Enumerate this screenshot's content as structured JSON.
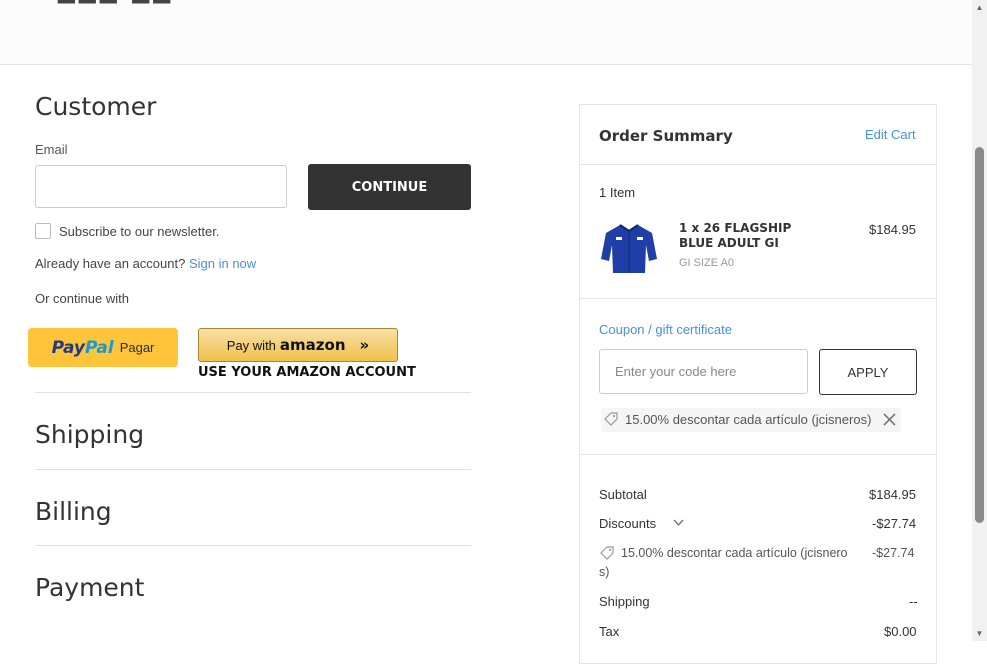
{
  "customer": {
    "title": "Customer",
    "email_label": "Email",
    "email_value": "",
    "continue_label": "CONTINUE",
    "subscribe_label": "Subscribe to our newsletter.",
    "account_prompt": "Already have an account?",
    "signin_label": "Sign in now",
    "or_continue": "Or continue with"
  },
  "payment_buttons": {
    "paypal_logo_1": "Pay",
    "paypal_logo_2": "Pal",
    "paypal_text": "Pagar",
    "amazon_pay_with": "Pay with",
    "amazon_brand": "amazon",
    "amazon_chevron": "»",
    "amazon_caption": "USE YOUR AMAZON ACCOUNT"
  },
  "sections": {
    "shipping": "Shipping",
    "billing": "Billing",
    "payment": "Payment"
  },
  "order_summary": {
    "title": "Order Summary",
    "edit_cart": "Edit Cart",
    "item_count": "1 Item",
    "item": {
      "name": "1 x 26 FLAGSHIP BLUE ADULT GI",
      "option": "GI SIZE A0",
      "price": "$184.95"
    },
    "coupon_link": "Coupon / gift certificate",
    "code_placeholder": "Enter your code here",
    "apply_label": "APPLY",
    "applied_coupon": "15.00% descontar cada artículo (jcisneros)",
    "totals": {
      "subtotal_label": "Subtotal",
      "subtotal_value": "$184.95",
      "discounts_label": "Discounts",
      "discounts_value": "-$27.74",
      "discount_detail_line1": "15.00% descontar cada artículo (jcisnero",
      "discount_detail_line2": "s)",
      "discount_detail_value": "-$27.74",
      "shipping_label": "Shipping",
      "shipping_value": "--",
      "tax_label": "Tax",
      "tax_value": "$0.00"
    }
  },
  "colors": {
    "accent_link": "#4a90d9",
    "continue_bg": "#333333",
    "paypal_yellow": "#ffc439",
    "amazon_gold": "#f0c14b"
  },
  "icons": [
    "tag-icon",
    "close-icon",
    "chevron-down-icon",
    "gi-shirt-image"
  ]
}
